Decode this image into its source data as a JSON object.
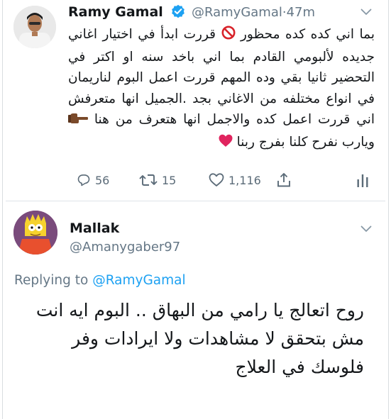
{
  "tweet": {
    "author_name": "Ramy Gamal",
    "author_handle": "@RamyGamal",
    "dot": "·",
    "time": "47m",
    "text_before_emoji1": "بما اني كده كده محظور ",
    "text_middle": " قررت ابدأ في اختيار اغاني جديده لألبومي القادم بما اني باخد سنه او اكتر في التحضير ثانيا بقي وده المهم قررت اعمل البوم لناريمان في انواع مختلفه من الاغاني بجد .الجميل انها متعرفش اني قررت اعمل كده والاجمل انها هتعرف من هنا ",
    "text_middle2": " ويارب نفرح كلنا بفرج ربنا ",
    "emoji": [
      "no-entry-icon",
      "pointing-hand-icon",
      "red-heart-icon"
    ],
    "stats": {
      "replies": "56",
      "retweets": "15",
      "likes": "1,116"
    }
  },
  "reply": {
    "author_name": "Mallak",
    "author_handle": "@Amanygaber97",
    "replying_prefix": "Replying to",
    "replying_to": "@RamyGamal",
    "text": "روح اتعالج يا رامي من البهاق .. البوم ايه انت مش بتحقق لا مشاهدات ولا ايرادات وفر فلوسك في العلاج"
  },
  "colors": {
    "accent": "#1da1f2",
    "secondary_text": "#657786",
    "heart": "#e0245e"
  }
}
